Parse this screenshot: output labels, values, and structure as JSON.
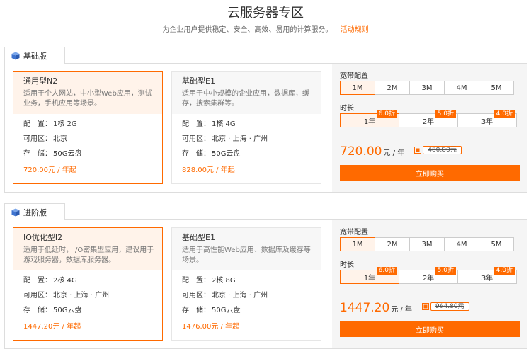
{
  "header": {
    "title": "云服务器专区",
    "subtitle": "为企业用户提供稳定、安全、高效、易用的计算服务。",
    "rules_link": "活动规则"
  },
  "colors": {
    "accent": "#ff6a00",
    "tab_icon": "#4a7fd6"
  },
  "sections": [
    {
      "tab_label": "基础版",
      "tab_icon": "cube-icon",
      "cards": [
        {
          "name": "通用型N2",
          "desc": "适用于个人网站，中小型Web应用，测试业务，手机应用等场景。",
          "spec_config_label": "配　置：",
          "spec_config": "1核 2G",
          "spec_zone_label": "可用区：",
          "spec_zone": "北京",
          "spec_storage_label": "存　储：",
          "spec_storage": "50G云盘",
          "price": "720.00元 / 年起"
        },
        {
          "name": "基础型E1",
          "desc": "适用于中小规模的企业应用，数据库，缓存，搜索集群等。",
          "spec_config_label": "配　置：",
          "spec_config": "1核 4G",
          "spec_zone_label": "可用区：",
          "spec_zone": "北京 · 上海 · 广州",
          "spec_storage_label": "存　储：",
          "spec_storage": "50G云盘",
          "price": "828.00元 / 年起"
        }
      ],
      "config": {
        "bandwidth_label": "宽带配置",
        "bandwidth_options": [
          "1M",
          "2M",
          "3M",
          "4M",
          "5M"
        ],
        "duration_label": "时长",
        "duration_options": [
          {
            "label": "1年",
            "discount": "6.0折"
          },
          {
            "label": "2年",
            "discount": "5.0折"
          },
          {
            "label": "3年",
            "discount": "4.0折"
          }
        ],
        "price": "720.00",
        "price_unit": "元 / 年",
        "original_price": "480.00元",
        "buy_label": "立即购买"
      }
    },
    {
      "tab_label": "进阶版",
      "tab_icon": "cube-icon",
      "cards": [
        {
          "name": "IO优化型I2",
          "desc": "适用于低延时，I/O密集型应用，建议用于游戏服务器，数据库服务器。",
          "spec_config_label": "配　置：",
          "spec_config": "2核 4G",
          "spec_zone_label": "可用区：",
          "spec_zone": "北京 · 上海 · 广州",
          "spec_storage_label": "存　储：",
          "spec_storage": "50G云盘",
          "price": "1447.20元 / 年起"
        },
        {
          "name": "基础型E1",
          "desc": "适用于高性能Web应用、数据库及缓存等场景。",
          "spec_config_label": "配　置：",
          "spec_config": "2核 8G",
          "spec_zone_label": "可用区：",
          "spec_zone": "北京 · 上海 · 广州",
          "spec_storage_label": "存　储：",
          "spec_storage": "50G云盘",
          "price": "1476.00元 / 年起"
        }
      ],
      "config": {
        "bandwidth_label": "宽带配置",
        "bandwidth_options": [
          "1M",
          "2M",
          "3M",
          "4M",
          "5M"
        ],
        "duration_label": "时长",
        "duration_options": [
          {
            "label": "1年",
            "discount": "6.0折"
          },
          {
            "label": "2年",
            "discount": "5.0折"
          },
          {
            "label": "3年",
            "discount": "4.0折"
          }
        ],
        "price": "1447.20",
        "price_unit": "元 / 年",
        "original_price": "964.80元",
        "buy_label": "立即购买"
      }
    }
  ]
}
